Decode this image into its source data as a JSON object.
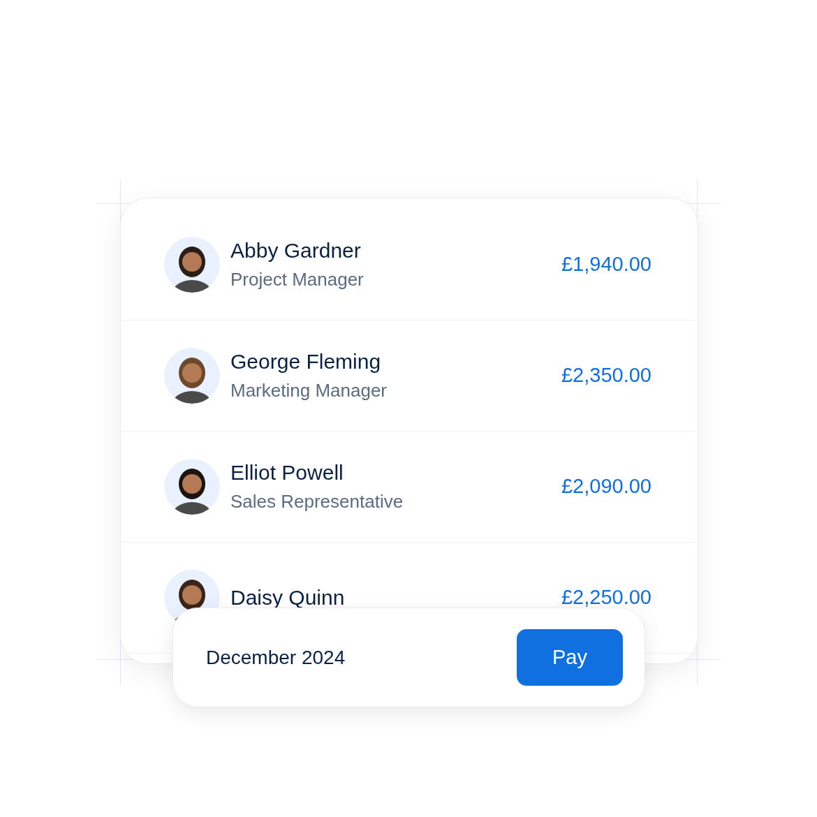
{
  "employees": [
    {
      "name": "Abby Gardner",
      "role": "Project Manager",
      "amount": "£1,940.00"
    },
    {
      "name": "George Fleming",
      "role": "Marketing Manager",
      "amount": "£2,350.00"
    },
    {
      "name": "Elliot Powell",
      "role": "Sales Representative",
      "amount": "£2,090.00"
    },
    {
      "name": "Daisy Quinn",
      "amount": "£2,250.00"
    }
  ],
  "payment": {
    "period": "December 2024",
    "button": "Pay"
  }
}
